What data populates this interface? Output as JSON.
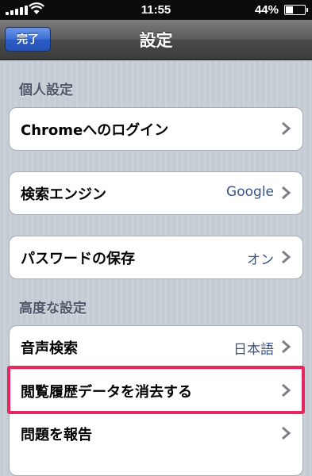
{
  "status_bar": {
    "time": "11:55",
    "battery": "44%",
    "battery_level": 0.44
  },
  "nav_bar": {
    "title": "設定",
    "done_label": "完了"
  },
  "sections": [
    {
      "header": "個人設定",
      "groups": [
        [
          {
            "label": "Chromeへのログイン",
            "value": ""
          }
        ],
        [
          {
            "label": "検索エンジン",
            "value": "Google"
          }
        ],
        [
          {
            "label": "パスワードの保存",
            "value": "オン"
          }
        ]
      ]
    },
    {
      "header": "高度な設定",
      "groups": [
        [
          {
            "label": "音声検索",
            "value": "日本語"
          },
          {
            "label": "閲覧履歴データを消去する",
            "value": ""
          },
          {
            "label": "問題を報告",
            "value": ""
          }
        ]
      ]
    }
  ],
  "colors": {
    "highlight": "#e8255f",
    "value_text": "#385487",
    "done_button": "#3c6fd6"
  }
}
